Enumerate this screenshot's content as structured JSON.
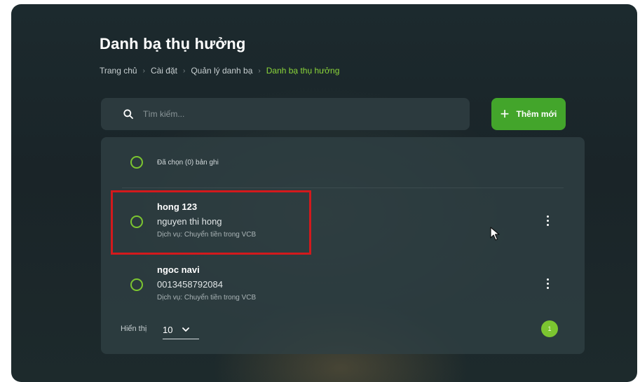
{
  "page": {
    "title": "Danh bạ thụ hưởng",
    "breadcrumb": [
      {
        "label": "Trang chủ"
      },
      {
        "label": "Cài đặt"
      },
      {
        "label": "Quản lý danh bạ"
      },
      {
        "label": "Danh bạ thụ hưởng"
      }
    ]
  },
  "search": {
    "placeholder": "Tìm kiếm...",
    "value": ""
  },
  "toolbar": {
    "add_label": "Thêm mới"
  },
  "list": {
    "selected_label": "Đã chọn (0) bản ghi",
    "items": [
      {
        "name": "hong 123",
        "subtitle": "nguyen thi hong",
        "service": "Dịch vụ: Chuyển tiền trong VCB"
      },
      {
        "name": "ngoc navi",
        "subtitle": "0013458792084",
        "service": "Dịch vụ: Chuyển tiền trong VCB"
      }
    ]
  },
  "footer": {
    "page_size_label": "Hiển thị",
    "page_size_value": "10",
    "current_page": "1"
  },
  "colors": {
    "accent": "#43a52b",
    "accent_light": "#7cc530",
    "highlight": "#d3191c"
  },
  "icons": {
    "search": "search-icon",
    "add": "plus-icon",
    "more": "kebab-menu-icon",
    "dropdown": "chevron-down-icon",
    "cursor": "mouse-pointer-icon"
  }
}
